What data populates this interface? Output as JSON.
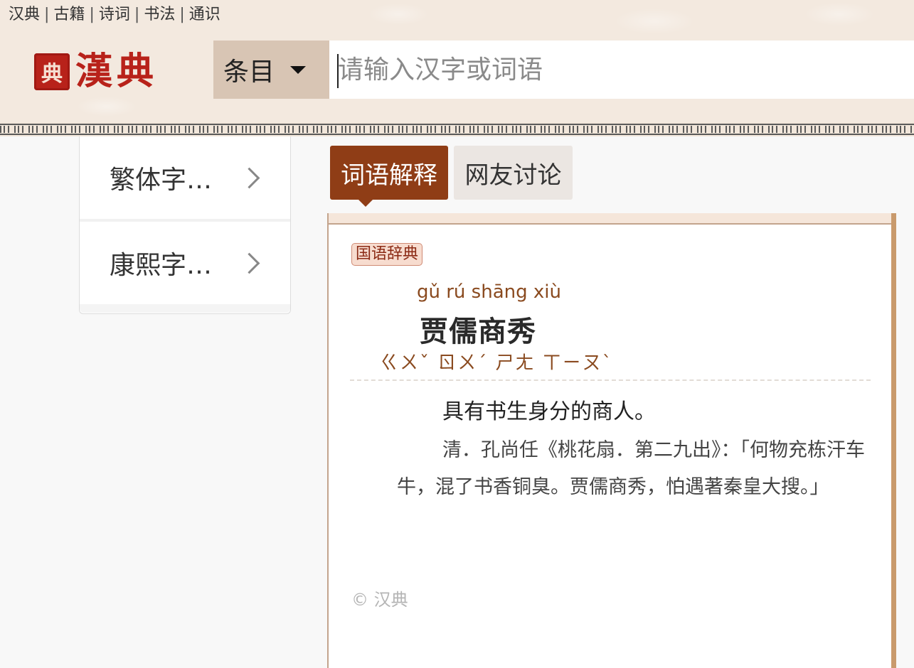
{
  "topnav": {
    "links": [
      "汉典",
      "古籍",
      "诗词",
      "书法",
      "通识"
    ],
    "separator": "|"
  },
  "logo": {
    "seal_char": "典",
    "text": "漢典"
  },
  "search": {
    "type_label": "条目",
    "placeholder": "请输入汉字或词语",
    "value": ""
  },
  "sidebar": {
    "items": [
      {
        "label": "繁体字…"
      },
      {
        "label": "康熙字…"
      }
    ]
  },
  "tabs": [
    {
      "label": "词语解释",
      "active": true
    },
    {
      "label": "网友讨论",
      "active": false
    }
  ],
  "entry": {
    "source_badge": "国语辞典",
    "pinyin": "gǔ rú shāng xiù",
    "word": "贾儒商秀",
    "zhuyin": "ㄍㄨˇ ㄖㄨˊ ㄕㄤ ㄒㄧㄡˋ",
    "definition": "具有书生身分的商人。",
    "quote": "清．孔尚任《桃花扇．第二九出》：「何物充栋汗车牛，混了书香铜臭。贾儒商秀，怕遇著秦皇大搜。」"
  },
  "footer": {
    "copyright": "© 汉典"
  },
  "colors": {
    "accent": "#8f3d16",
    "header_bg": "#f3e9df",
    "seal_red": "#b8221a",
    "search_type_bg": "#d8c5b4"
  }
}
